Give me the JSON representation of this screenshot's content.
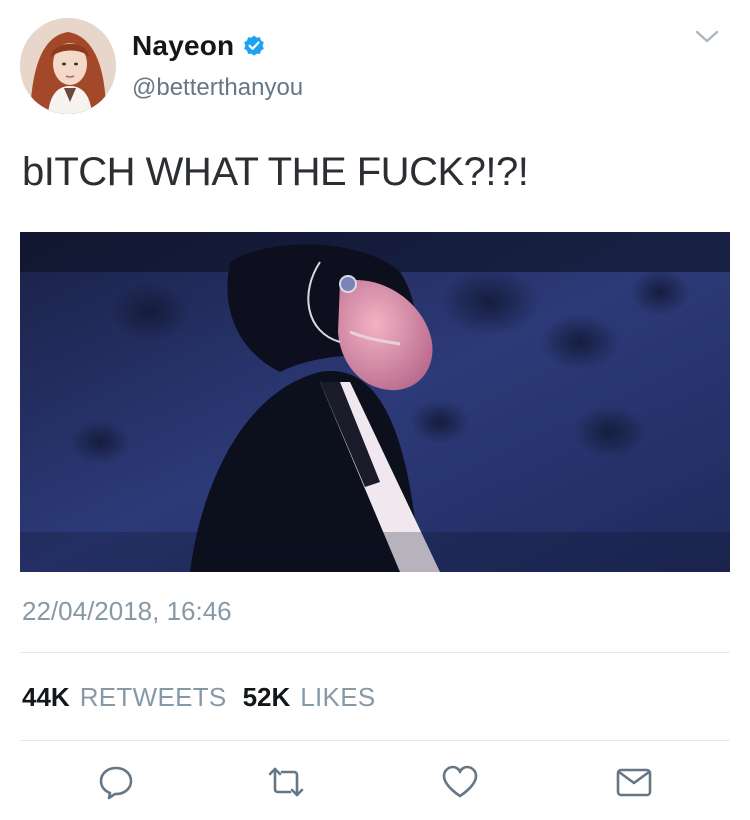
{
  "author": {
    "display_name": "Nayeon",
    "handle": "@betterthanyou",
    "verified": true,
    "avatar_icon": "profile-photo"
  },
  "tweet": {
    "text": "bITCH WHAT THE FUCK?!?!",
    "timestamp": "22/04/2018, 16:46",
    "media_description_icon": "photo"
  },
  "stats": {
    "retweets_count": "44K",
    "retweets_label": "RETWEETS",
    "likes_count": "52K",
    "likes_label": "LIKES"
  },
  "actions": {
    "reply_icon": "reply-icon",
    "retweet_icon": "retweet-icon",
    "like_icon": "heart-icon",
    "dm_icon": "envelope-icon"
  },
  "colors": {
    "verified_blue": "#1da1f2",
    "icon_gray": "#657786",
    "secondary_text": "#8899a6",
    "divider": "#e1e8ed"
  }
}
